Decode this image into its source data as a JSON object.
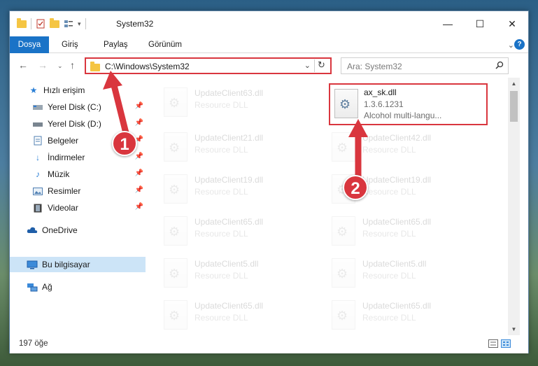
{
  "window": {
    "title": "System32",
    "controls": {
      "minimize": "—",
      "maximize": "☐",
      "close": "✕"
    }
  },
  "ribbon": {
    "tabs": [
      "Dosya",
      "Giriş",
      "Paylaş",
      "Görünüm"
    ]
  },
  "address": {
    "path": "C:\\Windows\\System32",
    "search_placeholder": "Ara: System32"
  },
  "sidebar": {
    "items": [
      {
        "label": "Hızlı erişim",
        "icon": "star-icon",
        "pinned": false,
        "indent": false
      },
      {
        "label": "Yerel Disk (C:)",
        "icon": "drive-icon",
        "pinned": true,
        "indent": true
      },
      {
        "label": "Yerel Disk (D:)",
        "icon": "drive-icon",
        "pinned": true,
        "indent": true
      },
      {
        "label": "Belgeler",
        "icon": "documents-icon",
        "pinned": true,
        "indent": true
      },
      {
        "label": "İndirmeler",
        "icon": "download-icon",
        "pinned": true,
        "indent": true
      },
      {
        "label": "Müzik",
        "icon": "music-icon",
        "pinned": true,
        "indent": true
      },
      {
        "label": "Resimler",
        "icon": "pictures-icon",
        "pinned": true,
        "indent": true
      },
      {
        "label": "Videolar",
        "icon": "videos-icon",
        "pinned": true,
        "indent": true
      },
      {
        "label": "OneDrive",
        "icon": "cloud-icon",
        "pinned": false,
        "indent": false
      },
      {
        "label": "Bu bilgisayar",
        "icon": "computer-icon",
        "pinned": false,
        "indent": false,
        "selected": true
      },
      {
        "label": "Ağ",
        "icon": "network-icon",
        "pinned": false,
        "indent": false
      }
    ]
  },
  "files": [
    {
      "name": "UpdateClient63.dll",
      "type": "Resource DLL",
      "faded": true
    },
    {
      "name": "ax_sk.dll",
      "version": "1.3.6.1231",
      "description": "Alcohol multi-langu...",
      "faded": false,
      "highlight": true
    },
    {
      "name": "UpdateClient21.dll",
      "type": "Resource DLL",
      "faded": true
    },
    {
      "name": "UpdateClient42.dll",
      "type": "Resource DLL",
      "faded": true
    },
    {
      "name": "UpdateClient19.dll",
      "type": "Resource DLL",
      "faded": true
    },
    {
      "name": "UpdateClient19.dll",
      "type": "Resource DLL",
      "faded": true
    },
    {
      "name": "UpdateClient65.dll",
      "type": "Resource DLL",
      "faded": true
    },
    {
      "name": "UpdateClient65.dll",
      "type": "Resource DLL",
      "faded": true
    },
    {
      "name": "UpdateClient5.dll",
      "type": "Resource DLL",
      "faded": true
    },
    {
      "name": "UpdateClient5.dll",
      "type": "Resource DLL",
      "faded": true
    },
    {
      "name": "UpdateClient65.dll",
      "type": "Resource DLL",
      "faded": true
    },
    {
      "name": "UpdateClient65.dll",
      "type": "Resource DLL",
      "faded": true
    }
  ],
  "status": {
    "count": "197 öğe"
  },
  "annotations": {
    "step1": "1",
    "step2": "2"
  },
  "colors": {
    "accent": "#1a73c7",
    "highlight": "#d9363e",
    "selected": "#cce4f7"
  }
}
